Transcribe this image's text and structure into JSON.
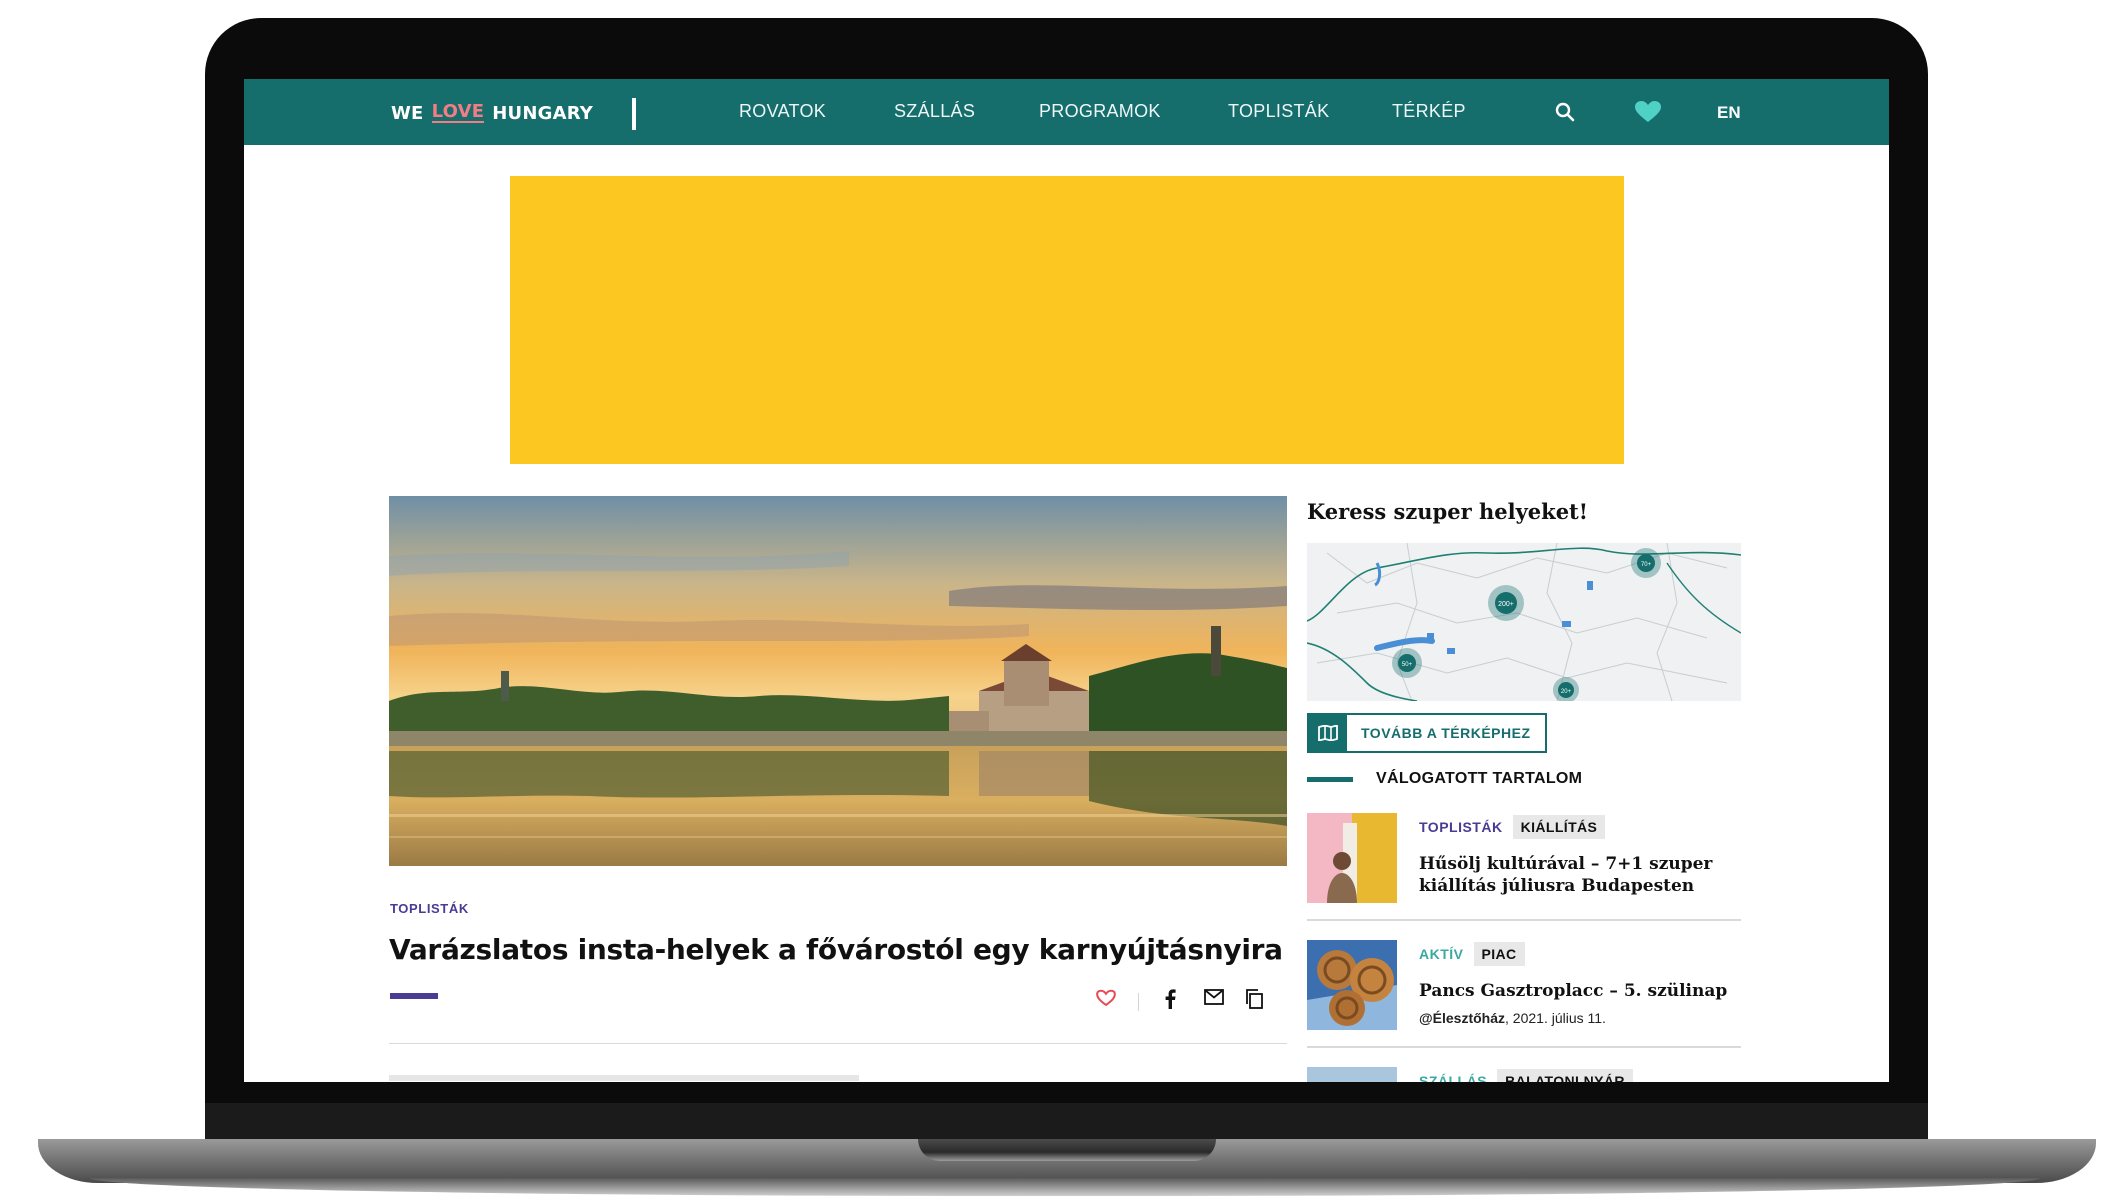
{
  "nav": {
    "logo": {
      "we": "WE",
      "love": "LOVE",
      "hungary": "HUNGARY"
    },
    "items": [
      {
        "label": "ROVATOK"
      },
      {
        "label": "SZÁLLÁS"
      },
      {
        "label": "PROGRAMOK"
      },
      {
        "label": "TOPLISTÁK"
      },
      {
        "label": "TÉRKÉP"
      }
    ],
    "language": "EN",
    "icons": [
      "search-icon",
      "heart-icon"
    ],
    "colors": {
      "bar": "#156d6c",
      "logo_accent": "#f47c85",
      "heart": "#4fd1c5"
    }
  },
  "ad": {
    "color": "#fbc720"
  },
  "article": {
    "category": "TOPLISTÁK",
    "title": "Varázslatos insta-helyek a fővárostól egy karnyújtásnyira",
    "accent": "#4a3b93",
    "share_icons": [
      "heart-icon",
      "facebook-icon",
      "mail-icon",
      "copy-icon"
    ]
  },
  "sidebar": {
    "map_title": "Keress szuper helyeket!",
    "map_button": "TOVÁBB A TÉRKÉPHEZ",
    "map_clusters": [
      "200+",
      "70+",
      "50+",
      "20+"
    ],
    "curated_title": "VÁLOGATOTT TARTALOM",
    "cards": [
      {
        "tag": "TOPLISTÁK",
        "tag_color": "#4a3b93",
        "badge": "KIÁLLÍTÁS",
        "title": "Hűsölj kultúrával – 7+1 szuper kiállítás júliusra Budapesten"
      },
      {
        "tag": "AKTÍV",
        "tag_color": "#3aa9a0",
        "badge": "PIAC",
        "title": "Pancs Gasztroplacc – 5. szülinap",
        "meta_place": "@Élesztőház",
        "meta_date": ", 2021. július 11."
      },
      {
        "tag": "SZÁLLÁS",
        "tag_color": "#3aa9a0",
        "badge": "BALATONI NYÁR"
      }
    ]
  }
}
